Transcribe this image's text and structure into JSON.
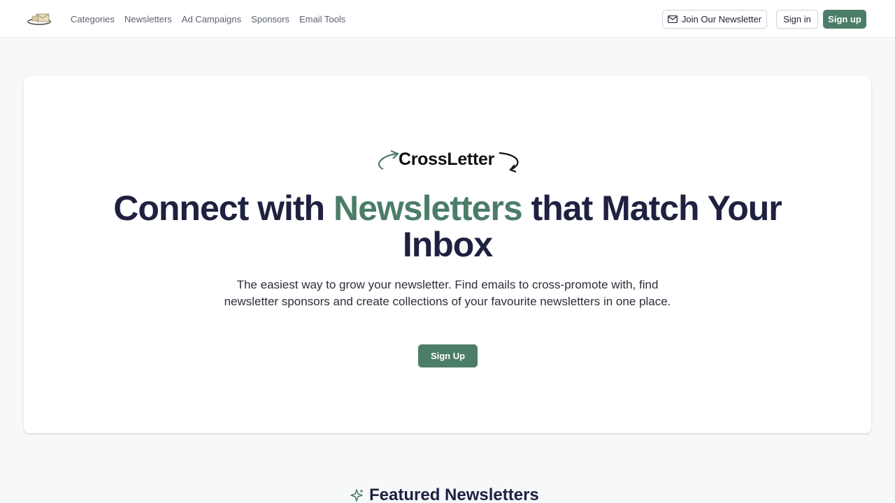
{
  "header": {
    "nav": [
      "Categories",
      "Newsletters",
      "Ad Campaigns",
      "Sponsors",
      "Email Tools"
    ],
    "join_label": "Join Our Newsletter",
    "signin_label": "Sign in",
    "signup_label": "Sign up"
  },
  "hero": {
    "brand": "CrossLetter",
    "headline_part1": "Connect with ",
    "headline_accent": "Newsletters",
    "headline_part2": " that Match Your Inbox",
    "subtext": "The easiest way to grow your newsletter. Find emails to cross-promote with, find newsletter sponsors and create collections of your favourite newsletters in one place.",
    "cta_label": "Sign Up"
  },
  "featured": {
    "title": "Featured Newsletters"
  },
  "colors": {
    "accent": "#4b7d68",
    "heading": "#1f2140",
    "background": "#f7f8fa"
  },
  "icons": [
    "logo-icon",
    "mail-icon",
    "brand-arrow-icon",
    "sparkle-icon"
  ]
}
